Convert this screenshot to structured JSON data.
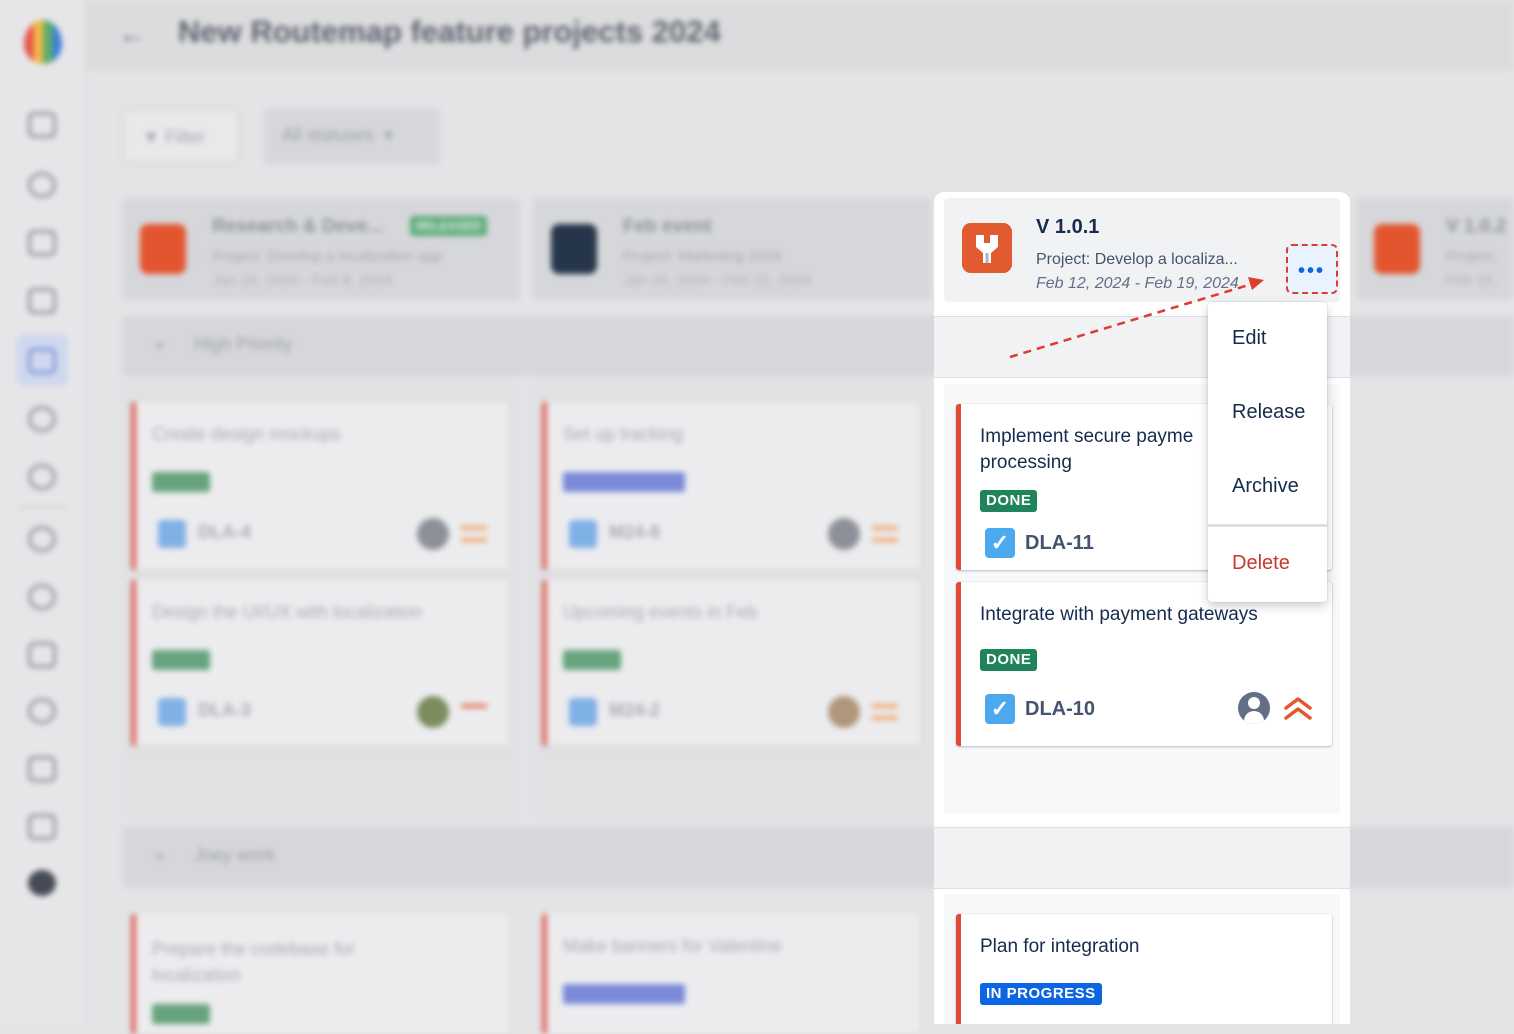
{
  "page": {
    "title": "New Routemap feature projects 2024",
    "back_icon": "arrow-left-icon"
  },
  "toolbar": {
    "filter_label": "Filter",
    "status_label": "All statuses"
  },
  "sidebar": {
    "icons": [
      "logo-icon",
      "monitor-icon",
      "cloud-icon",
      "calendar-icon",
      "grid-icon",
      "board-icon",
      "chat-icon",
      "bulb-icon",
      "settings-icon",
      "info-icon",
      "list-icon",
      "shield-icon",
      "message-icon",
      "keyboard-icon",
      "help-icon"
    ]
  },
  "versions": [
    {
      "title": "Research & Deve...",
      "badge": "RELEASED",
      "project": "Project: Develop a localization app",
      "dates": "Jan 29, 2024 - Feb 8, 2024"
    },
    {
      "title": "Feb event",
      "project": "Project: Marketing 2024",
      "dates": "Jan 25, 2024 - Feb 15, 2024"
    },
    {
      "title": "V 1.0.1",
      "project": "Project: Develop a localiza...",
      "dates": "Feb 12, 2024 - Feb 19, 2024"
    },
    {
      "title": "V 1.0.2",
      "project": "Project:",
      "dates": "Feb 19,"
    }
  ],
  "groups": [
    {
      "label": "High Priority"
    },
    {
      "label": "Joey work"
    }
  ],
  "background_cards": [
    {
      "title": "Create design mockups",
      "status": "DONE",
      "key": "DLA-4"
    },
    {
      "title": "Set up tracking",
      "status": "IN PROGRESS",
      "key": "M24-8"
    },
    {
      "title": "Design the UI/UX with localization",
      "status": "DONE",
      "key": "DLA-3"
    },
    {
      "title": "Upcoming events in Feb",
      "status": "DONE",
      "key": "M24-2"
    },
    {
      "title": "Prepare the codebase for localization",
      "status": "DONE",
      "key": ""
    },
    {
      "title": "Make banners for Valentine",
      "status": "IN PROGRESS",
      "key": ""
    }
  ],
  "focus_cards": [
    {
      "title": "Implement secure payme processing",
      "status": "DONE",
      "key": "DLA-11"
    },
    {
      "title": "Integrate with payment gateways",
      "status": "DONE",
      "key": "DLA-10",
      "priority": "highest"
    },
    {
      "title": "Plan for integration",
      "status": "IN PROGRESS"
    }
  ],
  "menu": {
    "edit": "Edit",
    "release": "Release",
    "archive": "Archive",
    "delete": "Delete"
  },
  "more_button_label": "•••",
  "colors": {
    "accent": "#0c66e4",
    "done": "#1f845a",
    "danger": "#c9372c",
    "card_border": "#e34935",
    "annotation": "#de3c2e"
  }
}
